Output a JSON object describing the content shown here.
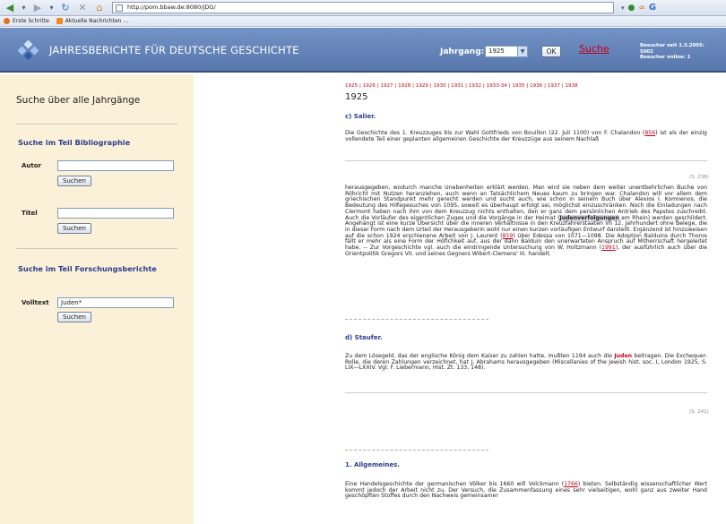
{
  "browser": {
    "url": "http://pom.bbaw.de:8080/JDG/",
    "bookmarks": [
      "Erste Schritte",
      "Aktuelle Nachrichten ..."
    ]
  },
  "header": {
    "title": "JAHRESBERICHTE FÜR DEUTSCHE GESCHICHTE",
    "jahrgang_label": "Jahrgang:",
    "jahrgang_value": "1925",
    "ok_label": "OK",
    "suche_label": "Suche",
    "besucher_line1": "Besucher seit 1.3.2005:",
    "besucher_line2": "5002",
    "besucher_line3": "Besucher online: 1"
  },
  "left": {
    "title": "Suche über alle Jahrgänge",
    "bib_title": "Suche im Teil Bibliographie",
    "autor_label": "Autor",
    "autor_value": "",
    "suchen1": "Suchen",
    "titel_label": "Titel",
    "titel_value": "",
    "suchen2": "Suchen",
    "forsch_title": "Suche im Teil Forschungsberichte",
    "volltext_label": "Volltext",
    "volltext_value": "Juden*",
    "suchen3": "Suchen"
  },
  "content": {
    "year_links": "1925 | 1926 | 1927 | 1928 | 1929 | 1930 | 1931 | 1932 | 1933-34 | 1935 | 1936 | 1937 | 1938",
    "year_title": "1925",
    "sec_c": "c) Salier.",
    "p1a": "Die Geschichte des 1. Kreuzzuges bis zur Wahl Gottfrieds von Bouillon (22. Juli 1100) von F. Chalandon (",
    "p1_ref": "856",
    "p1b": ") ist als der einzig vollendete Teil einer geplanten allgemeinen Geschichte der Kreuzzüge aus seinem Nachlaß",
    "page_ref1": "(S. 238)",
    "p2a": "herausgegeben, wodurch manche Unebenheiten erklärt werden. Man wird sie neben dem weiter unentbehrlichen Buche von Röhricht mit Nutzen heranziehen, auch wenn an Tatsächlichem Neues kaum zu bringen war. Chalandon will vor allem dem griechischen Standpunkt mehr gerecht werden und sucht auch, wie schon in seinem Buch über Alexios I. Komnenos, die Bedeutung des Hilfegesuches von 1095, soweit es überhaupt erfolgt sei, möglichst einzuschränken. Noch die Einladungen nach Clermont haben nach ihm von dem Kreuzzug nichts enthalten, den er ganz dem persönlichen Antrieb des Papstes zuschreibt. Auch die Vorläufer des eigentlichen Zuges und die Vorgänge in der Heimat (",
    "p2_hl": "Judenverfolgungen",
    "p2b": " am Rhein) werden geschildert. Angehängt ist eine kurze Übersicht über die inneren Verhältnisse in den Kreuzfahrerstaaten im 12. Jahrhundert ohne Belege, die in dieser Form nach dem Urteil der Herausgeberin wohl nur einen kurzen vorläufigen Entwurf darstellt. Ergänzend ist hinzuweisen auf die schon 1924 erschienene Arbeit von J. Laurent (",
    "p2_ref1": "859",
    "p2c": ") über Edessa von 1071—1098. Die Adoption Balduins durch Thoros fällt er mehr als eine Form der Höfichkeit auf, aus der dann Balduin den unerwarteten Anspruch auf Mitherrschaft hergeleitet habe. -- Zur Vorgeschichte vgl. auch die eindringende Untersuchung von W. Holtzmann (",
    "p2_ref2": "1991",
    "p2d": "), der ausführlich auch über die Orientpolitik Gregors VII. und seines Gegners Wibert-Clemens' III. handelt.",
    "sec_d": "d) Staufer.",
    "p3a": "Zu dem Lösegeld, das der englische König dem Kaiser zu zahlen hatte, mußten 1194 auch die ",
    "p3_hl": "Juden",
    "p3b": " beitragen. Die Exchequer-Rolle, die deren Zahlungen verzeichnet, hat J. Abrahams herausgegeben (Miscellanies of the Jewish hist. soc. I, London 1925, S. LIX—LXXIV. Vgl. F. Liebermann, Hist. Zt. 133, 148).",
    "page_ref2": "(S. 241)",
    "sec_1": "1. Allgemeines.",
    "p4a": "Eine Handelsgeschichte der germanischen Völker bis 1660 will Volckmann (",
    "p4_ref": "1766",
    "p4b": ") bieten. Selbständig wissenschaftlicher Wert kommt jedoch der Arbeit nicht zu. Der Versuch, die Zusammenfassung eines sehr vielseitigen, wohl ganz aus zweiter Hand geschöpften Stoffes durch den Nachweis gemeinsamer"
  },
  "colors": {
    "header_bg": "#6585bb",
    "left_bg": "#fbf1d8",
    "section_title": "#2c3d8e",
    "link_red": "#c8001a"
  }
}
